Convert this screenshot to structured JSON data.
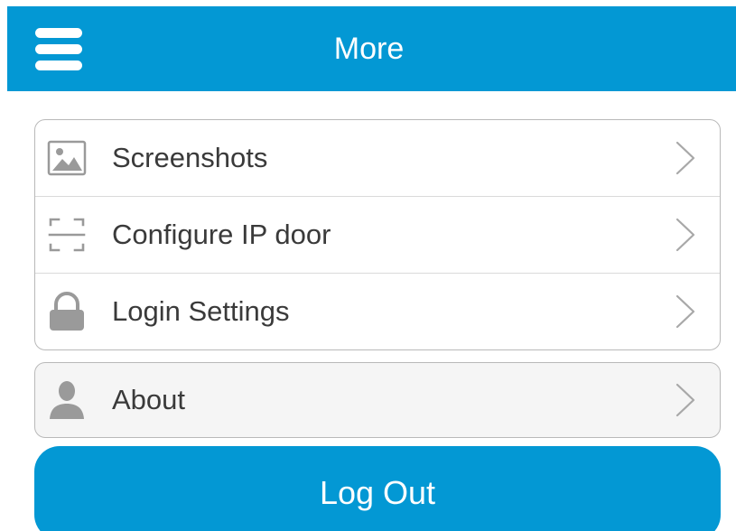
{
  "header": {
    "title": "More"
  },
  "menu_groups": [
    {
      "items": [
        {
          "label": "Screenshots",
          "icon": "image-icon"
        },
        {
          "label": "Configure IP door",
          "icon": "scan-frame-icon"
        },
        {
          "label": "Login Settings",
          "icon": "lock-icon"
        }
      ]
    },
    {
      "items": [
        {
          "label": "About",
          "icon": "person-icon"
        }
      ]
    }
  ],
  "actions": {
    "logout_label": "Log Out"
  },
  "colors": {
    "accent": "#0398d4",
    "icon_gray": "#9a9a9a",
    "chevron_gray": "#a8a8a8",
    "text": "#3a3a3a"
  }
}
